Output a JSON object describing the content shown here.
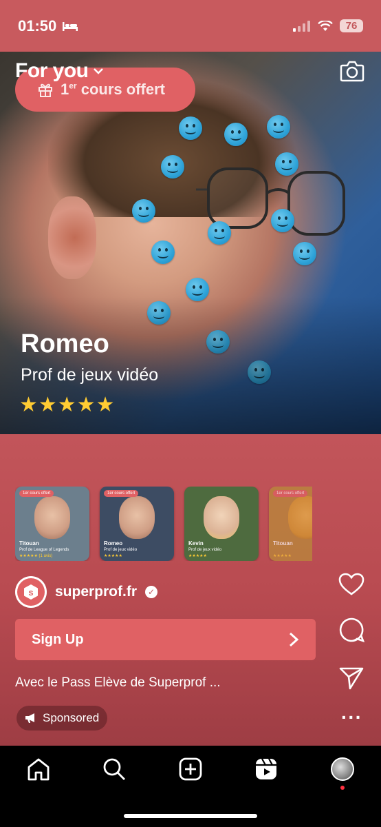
{
  "status": {
    "time": "01:50",
    "battery": "76"
  },
  "header": {
    "feed_label": "For you"
  },
  "promo": {
    "label_prefix": "1",
    "label_sup": "er",
    "label_rest": " cours offert"
  },
  "hero": {
    "name": "Romeo",
    "subject": "Prof de jeux vidéo",
    "stars": "★★★★★"
  },
  "cards": [
    {
      "tag": "1er cours offert",
      "name": "Titouan",
      "subject": "Prof de League of Legends",
      "stars": "★★★★★ (1 avis)",
      "bg": "#6c7f8d"
    },
    {
      "tag": "1er cours offert",
      "name": "Romeo",
      "subject": "Prof de jeux vidéo",
      "stars": "★★★★★",
      "bg": "#3d4c63"
    },
    {
      "tag": "",
      "name": "Kevin",
      "subject": "Prof de jeux vidéo",
      "stars": "★★★★★",
      "bg": "#4e6b3f"
    },
    {
      "tag": "1er cours offert",
      "name": "Titouan",
      "subject": "",
      "stars": "★★★★★",
      "bg": "#b98a3a"
    }
  ],
  "brand": {
    "name": "superprof.fr",
    "logo_letter": "s"
  },
  "cta": {
    "label": "Sign Up"
  },
  "caption": "Avec le Pass Elève de Superprof ...",
  "sponsored_label": "Sponsored",
  "colors": {
    "accent": "#e06164",
    "background": "#c2555a",
    "star": "#ffcc33"
  }
}
